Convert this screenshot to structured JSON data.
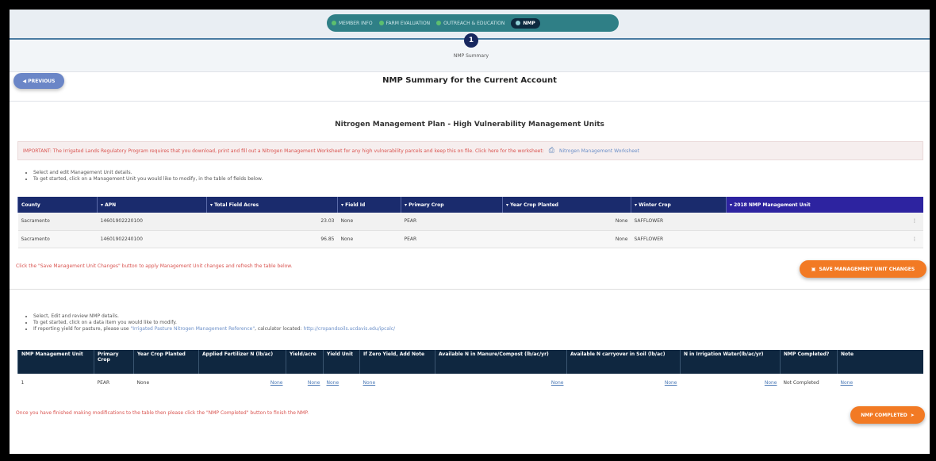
{
  "nav": {
    "steps": [
      {
        "label": "MEMBER INFO",
        "state": "done"
      },
      {
        "label": "FARM EVALUATION",
        "state": "done"
      },
      {
        "label": "OUTREACH & EDUCATION",
        "state": "done"
      },
      {
        "label": "NMP",
        "state": "active"
      }
    ],
    "current_step_number": "1",
    "current_step_label": "NMP Summary"
  },
  "header": {
    "previous_label": "PREVIOUS",
    "page_title": "NMP Summary for the Current Account"
  },
  "section": {
    "title": "Nitrogen Management Plan - High Vulnerability Management Units",
    "important_text": "IMPORTANT: The Irrigated Lands Regulatory Program requires that you download, print and fill out a Nitrogen Management Worksheet for any high vulnerability parcels and keep this on file. Click here for the worksheet:",
    "worksheet_link": "Nitrogen Management Worksheet"
  },
  "instructions1": [
    "Select and edit Management Unit details.",
    "To get started, click on a Management Unit you would like to modify, in the table of fields below."
  ],
  "table1": {
    "headers": [
      "County",
      "APN",
      "Total Field Acres",
      "Field Id",
      "Primary Crop",
      "Year Crop Planted",
      "Winter Crop",
      "2018 NMP Management Unit"
    ],
    "rows": [
      {
        "county": "Sacramento",
        "apn": "14601902220100",
        "acres": "23.03",
        "field_id": "None",
        "crop": "PEAR",
        "year": "None",
        "winter": "SAFFLOWER",
        "unit": ""
      },
      {
        "county": "Sacramento",
        "apn": "14601902240100",
        "acres": "96.85",
        "field_id": "None",
        "crop": "PEAR",
        "year": "None",
        "winter": "SAFFLOWER",
        "unit": ""
      }
    ]
  },
  "notes": {
    "save_instruction": "Click the \"Save Management Unit Changes\" button to apply Management Unit changes and refresh the table below.",
    "save_button": "SAVE MANAGEMENT UNIT CHANGES",
    "finish_instruction": "Once you have finished making modifications to the table then please click the \"NMP Completed\" button to finish the NMP.",
    "nmp_button": "NMP COMPLETED"
  },
  "instructions2": {
    "items": [
      "Select, Edit and review NMP details.",
      "To get started, click on a data item you would like to modify.",
      "If reporting yield for pasture, please use"
    ],
    "pasture_link": "\"Irrigated Pasture Nitrogen Management Reference\"",
    "calc_text": ", calculator located:",
    "calc_link": "http://cropandsoils.ucdavis.edu/ipcalc/"
  },
  "table2": {
    "headers": [
      "NMP Management Unit",
      "Primary Crop",
      "Year Crop Planted",
      "Applied Fertilizer N (lb/ac)",
      "Yield/acre",
      "Yield Unit",
      "If Zero Yield, Add Note",
      "Available N in Manure/Compost (lb/ac/yr)",
      "Available N carryover in Soil (lb/ac)",
      "N in Irrigation Water(lb/ac/yr)",
      "NMP Completed?",
      "Note"
    ],
    "row": {
      "unit": "1",
      "crop": "PEAR",
      "year": "None",
      "fertilizer": "None",
      "yield": "None",
      "yield_unit": "None",
      "zero_note": "None",
      "manure": "None",
      "carryover": "None",
      "irrigation": "None",
      "completed": "Not Completed",
      "note": "None"
    }
  },
  "icons": {
    "kebab": "kebab-menu-icon",
    "save": "save-icon",
    "send": "send-icon",
    "print": "print-icon",
    "back": "back-arrow-icon"
  },
  "colors": {
    "accent": "#f27a24",
    "table_header": "#1a2b6d",
    "table2_header": "#0f2740",
    "important_text": "#d9534f",
    "nav": "#2f7f86",
    "link": "#4a78b5"
  }
}
